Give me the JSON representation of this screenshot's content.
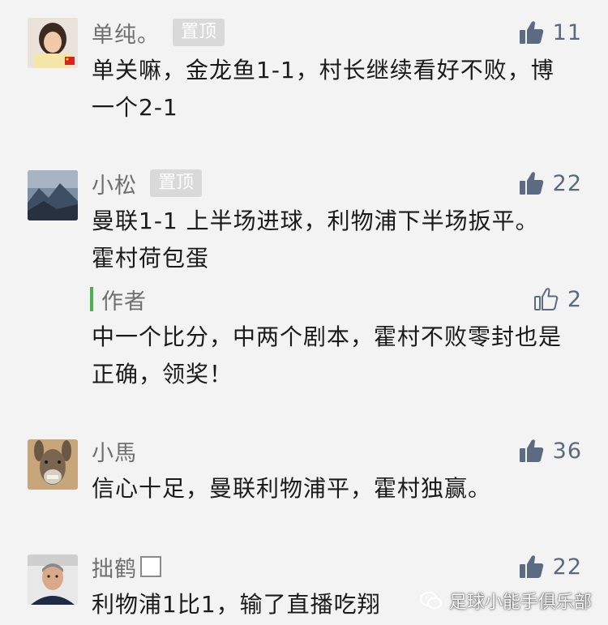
{
  "comments": [
    {
      "name": "单纯。",
      "badge": "置顶",
      "likes": "11",
      "text": "单关嘛，金龙鱼1-1，村长继续看好不败，博一个2-1",
      "avatar_icon": "portrait-avatar"
    },
    {
      "name": "小松",
      "badge": "置顶",
      "likes": "22",
      "text": "曼联1-1 上半场进球，利物浦下半场扳平。霍村荷包蛋",
      "avatar_icon": "mountain-avatar",
      "reply": {
        "label": "作者",
        "likes": "2",
        "text": "中一个比分，中两个剧本，霍村不败零封也是正确，领奖！"
      }
    },
    {
      "name": "小馬",
      "likes": "36",
      "text": "信心十足，曼联利物浦平，霍村独赢。",
      "avatar_icon": "donkey-avatar"
    },
    {
      "name": "拙鹤",
      "likes": "22",
      "text": "利物浦1比1，输了直播吃翔",
      "avatar_icon": "man-portrait-avatar"
    }
  ],
  "watermark": {
    "text": "足球小能手俱乐部",
    "icon": "wechat-icon"
  },
  "colors": {
    "background": "#f3f3f3",
    "like_filled": "#5b6b82",
    "author_bar": "#4caf50"
  }
}
